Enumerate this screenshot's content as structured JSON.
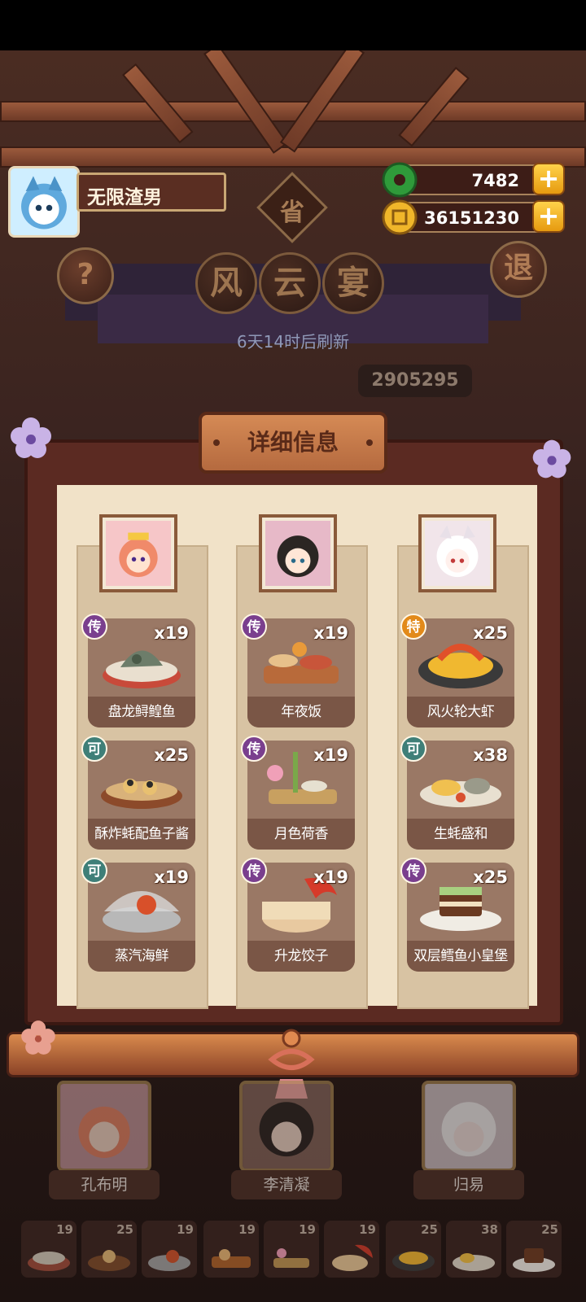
{
  "player": {
    "name": "无限渣男"
  },
  "currencies": {
    "jade": "7482",
    "coins": "36151230"
  },
  "event": {
    "region_char": "省",
    "title_chars": [
      "风",
      "云",
      "宴"
    ],
    "refresh_text": "6天14时后刷新",
    "score_text": "2905295"
  },
  "buttons": {
    "help": "?",
    "exit": "退",
    "plus": "+"
  },
  "panel": {
    "title": "详细信息",
    "columns": [
      {
        "dishes": [
          {
            "badge": "传",
            "badge_type": "legend",
            "qty": "x19",
            "name": "盘龙鲟鳇鱼"
          },
          {
            "badge": "可",
            "badge_type": "common",
            "qty": "x25",
            "name": "酥炸蚝配鱼子酱"
          },
          {
            "badge": "可",
            "badge_type": "common",
            "qty": "x19",
            "name": "蒸汽海鲜"
          }
        ]
      },
      {
        "dishes": [
          {
            "badge": "传",
            "badge_type": "legend",
            "qty": "x19",
            "name": "年夜饭"
          },
          {
            "badge": "传",
            "badge_type": "legend",
            "qty": "x19",
            "name": "月色荷香"
          },
          {
            "badge": "传",
            "badge_type": "legend",
            "qty": "x19",
            "name": "升龙饺子"
          }
        ]
      },
      {
        "dishes": [
          {
            "badge": "特",
            "badge_type": "special",
            "qty": "x25",
            "name": "风火轮大虾"
          },
          {
            "badge": "可",
            "badge_type": "common",
            "qty": "x38",
            "name": "生蚝盛和"
          },
          {
            "badge": "传",
            "badge_type": "legend",
            "qty": "x25",
            "name": "双层鳕鱼小皇堡"
          }
        ]
      }
    ]
  },
  "chefs": [
    {
      "name": "孔布明"
    },
    {
      "name": "李清凝"
    },
    {
      "name": "归易"
    }
  ],
  "tray": [
    "19",
    "25",
    "19",
    "19",
    "19",
    "19",
    "25",
    "38",
    "25"
  ],
  "colors": {
    "legend": "#7a3f8e",
    "common": "#3f7f78",
    "special": "#e28a1a",
    "board": "#5b2a22",
    "paper": "#f1e2c8"
  }
}
